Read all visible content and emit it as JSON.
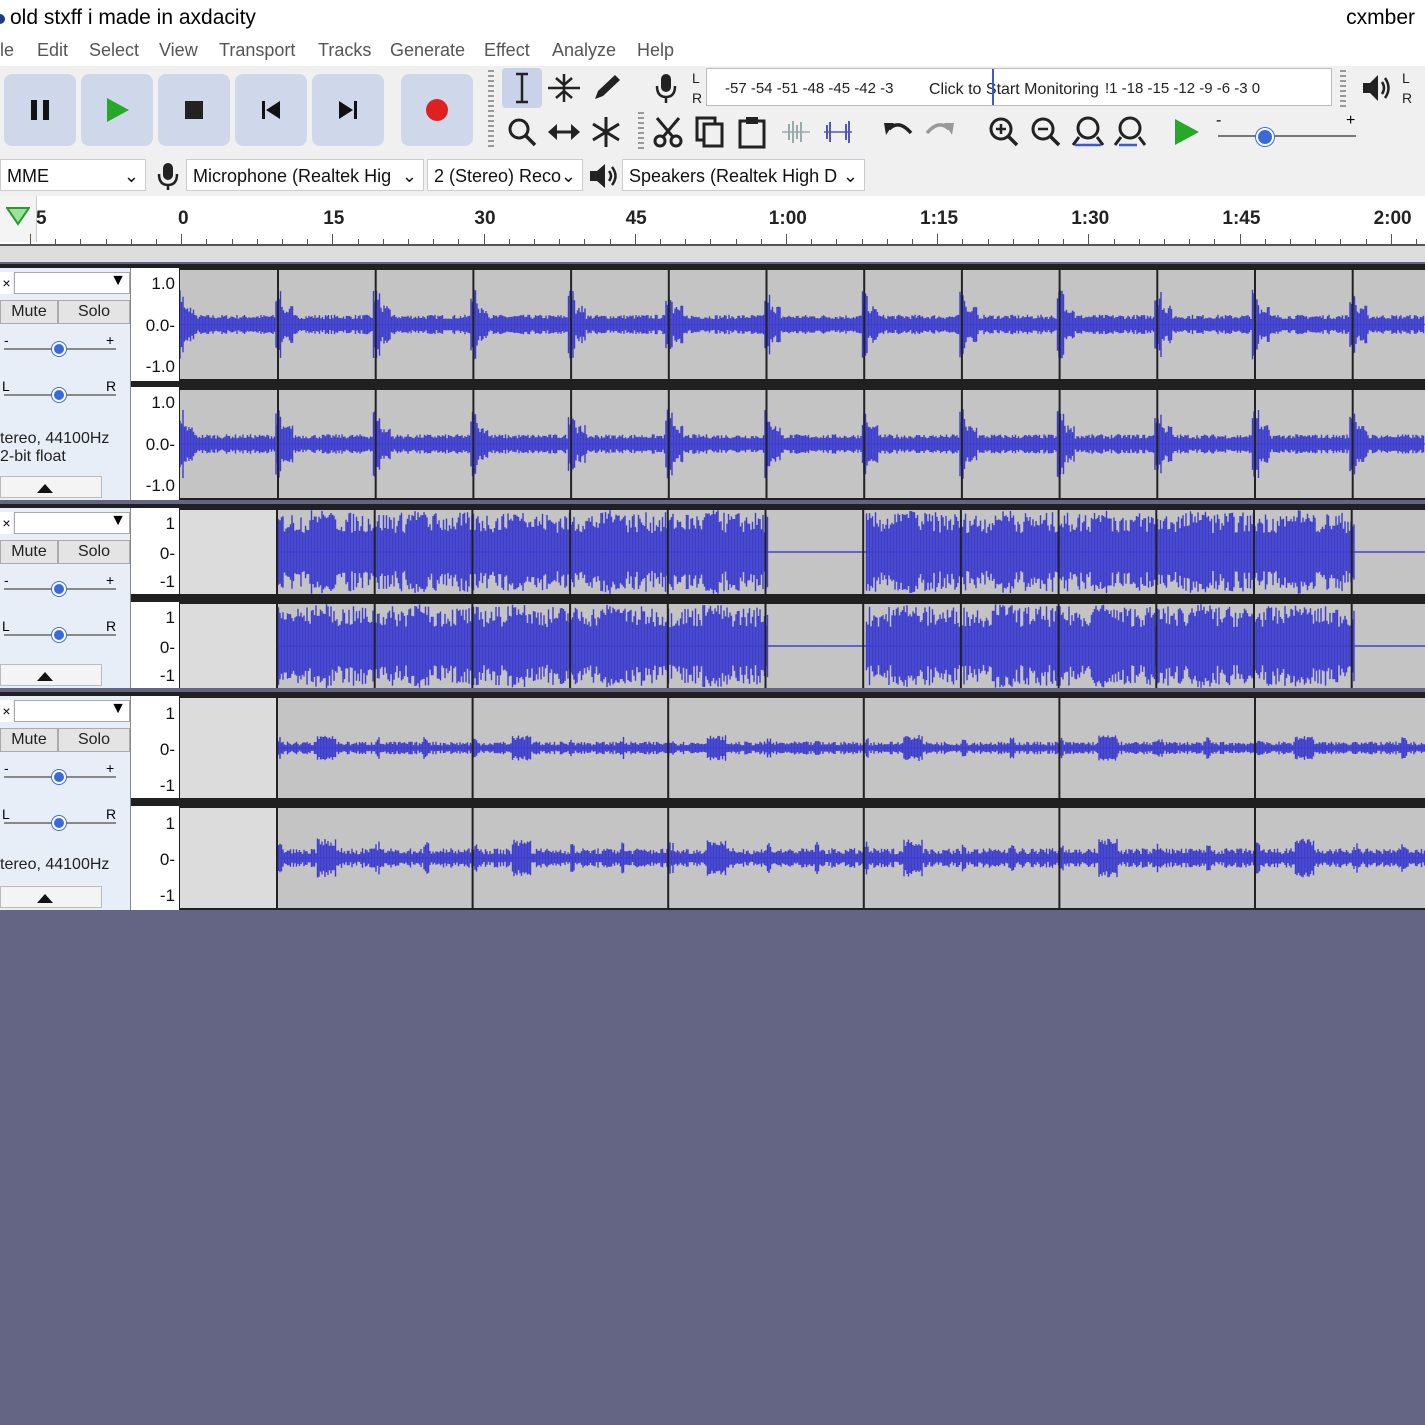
{
  "window": {
    "title": "old stxff i made in axdacity",
    "right_text": "cxmber"
  },
  "menu": [
    "le",
    "Edit",
    "Select",
    "View",
    "Transport",
    "Tracks",
    "Generate",
    "Effect",
    "Analyze",
    "Help"
  ],
  "meter": {
    "rec_L": "L",
    "rec_R": "R",
    "scale_left": "-57 -54 -51 -48 -45 -42 -3",
    "monitor_text": "Click to Start Monitoring",
    "scale_right": "!1 -18 -15 -12 -9 -6 -3 0",
    "play_L": "L",
    "play_R": "R"
  },
  "speed": {
    "minus": "-",
    "plus": "+"
  },
  "devices": {
    "host": "MME",
    "recording": "Microphone (Realtek Hig",
    "channels": "2 (Stereo) Reco",
    "playback": "Speakers (Realtek High D"
  },
  "ruler": {
    "start": "5",
    "labels": [
      "0",
      "15",
      "30",
      "45",
      "1:00",
      "1:15",
      "1:30",
      "1:45",
      "2:00"
    ]
  },
  "tracks": [
    {
      "mute": "Mute",
      "solo": "Solo",
      "gain_minus": "-",
      "gain_plus": "+",
      "pan_l": "L",
      "pan_r": "R",
      "info1": "tereo, 44100Hz",
      "info2": "2-bit float",
      "scale": [
        "1.0",
        "0.0-",
        "-1.0"
      ]
    },
    {
      "mute": "Mute",
      "solo": "Solo",
      "gain_minus": "-",
      "gain_plus": "+",
      "pan_l": "L",
      "pan_r": "R",
      "info1": "",
      "info2": "",
      "scale": [
        "1",
        "0-",
        "-1"
      ]
    },
    {
      "mute": "Mute",
      "solo": "Solo",
      "gain_minus": "-",
      "gain_plus": "+",
      "pan_l": "L",
      "pan_r": "R",
      "info1": "tereo, 44100Hz",
      "info2": "",
      "scale": [
        "1",
        "0-",
        "-1"
      ]
    }
  ],
  "colors": {
    "waveform": "#3c3ccd",
    "record": "#e02020",
    "play": "#28a828",
    "background": "#646485"
  }
}
